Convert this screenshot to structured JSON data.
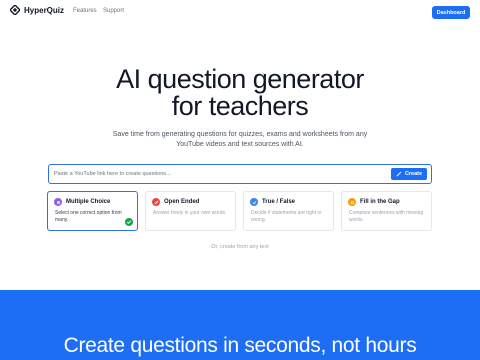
{
  "nav": {
    "brand": "HyperQuiz",
    "links": [
      "Features",
      "Support"
    ],
    "dashboard_label": "Dashboard"
  },
  "hero": {
    "title_line1": "AI question generator",
    "title_line2": "for teachers",
    "subtitle": "Save time from generating questions for quizzes, exams and worksheets from any YouTube videos and text sources with AI."
  },
  "search": {
    "placeholder": "Paste a YouTube link here to create questions...",
    "value": "",
    "button_label": "Create"
  },
  "cards": [
    {
      "title": "Multiple Choice",
      "desc": "Select one correct option from many.",
      "icon": "list-icon",
      "color": "#8b5cf6",
      "selected": true
    },
    {
      "title": "Open Ended",
      "desc": "Answer freely in your own words.",
      "icon": "pencil-icon",
      "color": "#ef4444",
      "selected": false
    },
    {
      "title": "True / False",
      "desc": "Decide if statements are right or wrong.",
      "icon": "check-icon",
      "color": "#3b82f6",
      "selected": false
    },
    {
      "title": "Fill in the Gap",
      "desc": "Complete sentences with missing words.",
      "icon": "gap-icon",
      "color": "#f59e0b",
      "selected": false
    }
  ],
  "alt_create": "Or, create from any text",
  "section": {
    "title": "Create questions in seconds, not hours",
    "bg_color": "#1d6ef5"
  },
  "colors": {
    "accent": "#1d6ef5",
    "check": "#16a34a"
  }
}
